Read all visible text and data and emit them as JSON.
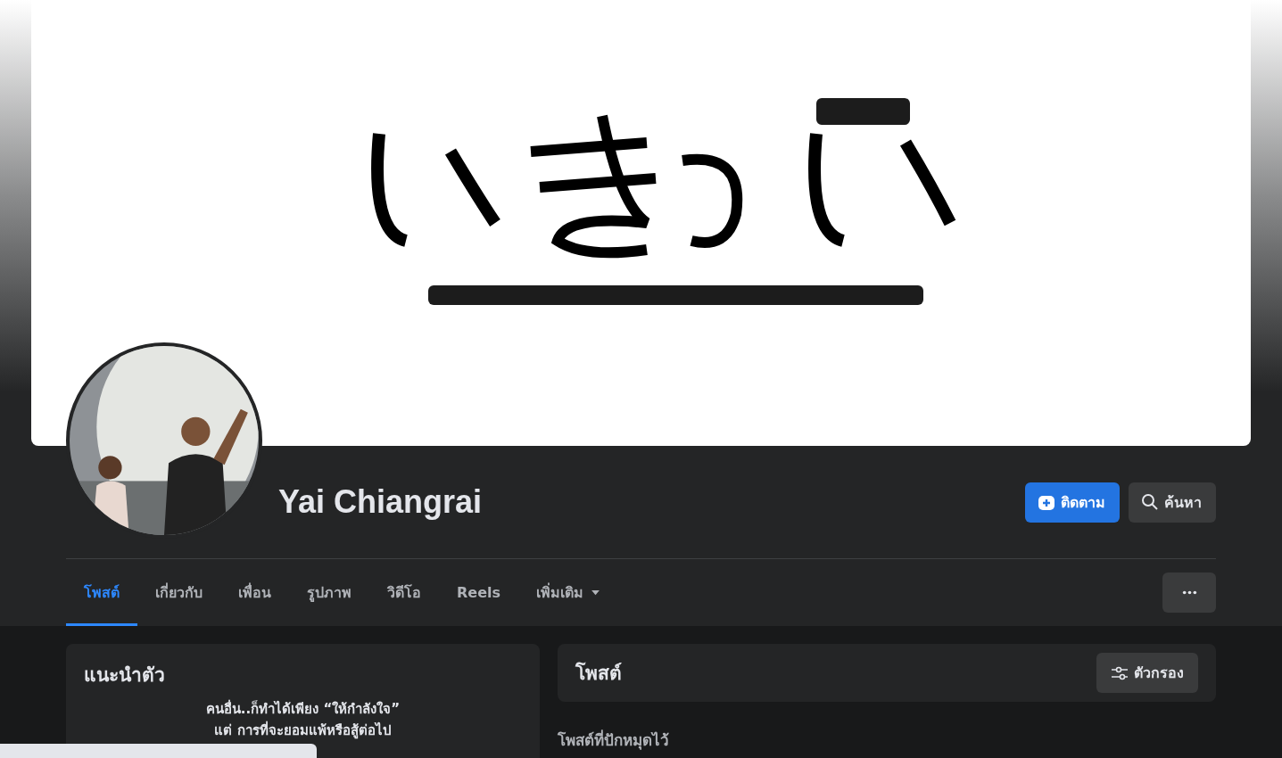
{
  "profile": {
    "name": "Yai Chiangrai"
  },
  "actions": [
    {
      "label": "ติดตาม",
      "kind": "follow"
    },
    {
      "label": "ค้นหา",
      "kind": "search"
    }
  ],
  "tabs": [
    {
      "label": "โพสต์",
      "selected": true,
      "kind": "link"
    },
    {
      "label": "เกี่ยวกับ",
      "selected": false,
      "kind": "link"
    },
    {
      "label": "เพื่อน",
      "selected": false,
      "kind": "link"
    },
    {
      "label": "รูปภาพ",
      "selected": false,
      "kind": "link"
    },
    {
      "label": "วิดีโอ",
      "selected": false,
      "kind": "link"
    },
    {
      "label": "Reels",
      "selected": false,
      "kind": "link"
    },
    {
      "label": "เพิ่มเติม",
      "selected": false,
      "kind": "menu"
    }
  ],
  "intro": {
    "title": "แนะนำตัว",
    "bio": [
      "คนอื่น..ก็ทำได้เพียง “ให้กำลังใจ”",
      "แต่ การที่จะยอมแพ้หรือสู้ต่อไป"
    ]
  },
  "posts": {
    "title": "โพสต์",
    "filter": "ตัวกรอง",
    "pinned_heading": "โพสต์ที่ปักหมุดไว้"
  }
}
